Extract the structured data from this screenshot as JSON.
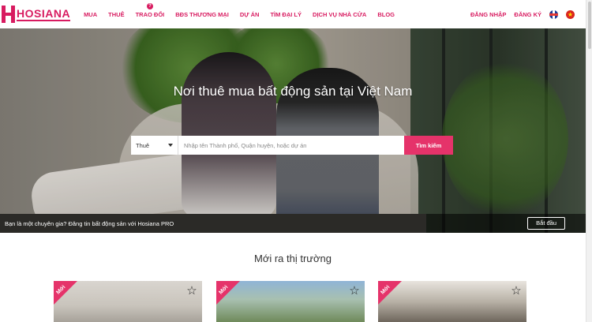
{
  "brand": {
    "name": "HOSIANA",
    "color": "#d81b60",
    "accent": "#e5336a"
  },
  "nav": {
    "items": [
      {
        "label": "MUA"
      },
      {
        "label": "THUÊ"
      },
      {
        "label": "TRAO ĐỔI",
        "badge": "?"
      },
      {
        "label": "BĐS THƯƠNG MẠI"
      },
      {
        "label": "DỰ ÁN"
      },
      {
        "label": "TÌM ĐẠI LÝ"
      },
      {
        "label": "DỊCH VỤ NHÀ CỬA"
      },
      {
        "label": "BLOG"
      }
    ],
    "login": "ĐĂNG NHẬP",
    "register": "ĐĂNG KÝ",
    "languages": [
      "uk-flag-icon",
      "vietnam-flag-icon"
    ]
  },
  "hero": {
    "title": "Nơi thuê mua bất động sản tại Việt Nam",
    "search": {
      "type_value": "Thuê",
      "placeholder": "Nhập tên Thành phố, Quận huyện, hoặc dự án",
      "button": "Tìm kiếm"
    },
    "pro": {
      "text": "Bạn là một chuyên gia? Đăng tin bất động sản với Hosiana PRO",
      "button": "Bắt đầu"
    }
  },
  "listings": {
    "title": "Mới ra thị trường",
    "cards": [
      {
        "badge": "Mới",
        "icon": "star-outline-icon"
      },
      {
        "badge": "Mới",
        "icon": "star-outline-icon"
      },
      {
        "badge": "Mới",
        "icon": "star-outline-icon"
      }
    ]
  }
}
